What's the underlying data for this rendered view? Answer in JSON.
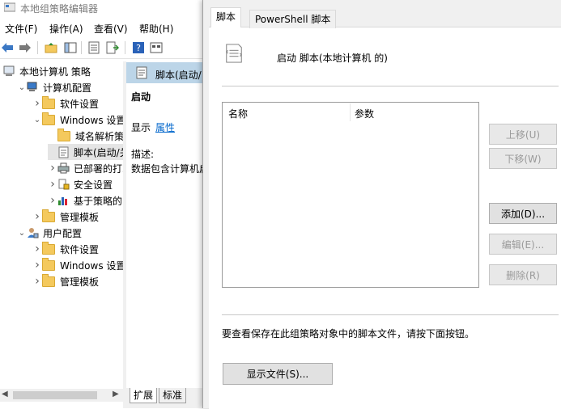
{
  "window": {
    "title": "本地组策略编辑器"
  },
  "menu": [
    "文件(F)",
    "操作(A)",
    "查看(V)",
    "帮助(H)"
  ],
  "tree": {
    "items": [
      {
        "label": "本地计算机 策略",
        "level": 0,
        "expander": "",
        "icon": "computer-policy-icon"
      },
      {
        "label": "计算机配置",
        "level": 1,
        "expander": "open",
        "icon": "computer-icon"
      },
      {
        "label": "软件设置",
        "level": 2,
        "expander": "closed",
        "icon": "folder-icon"
      },
      {
        "label": "Windows 设置",
        "level": 2,
        "expander": "open",
        "icon": "folder-icon"
      },
      {
        "label": "域名解析策略",
        "level": 3,
        "expander": "",
        "icon": "folder-icon"
      },
      {
        "label": "脚本(启动/关",
        "level": 3,
        "expander": "",
        "icon": "script-icon",
        "selected": true
      },
      {
        "label": "已部署的打印",
        "level": 3,
        "expander": "closed",
        "icon": "printer-icon"
      },
      {
        "label": "安全设置",
        "level": 3,
        "expander": "closed",
        "icon": "security-icon"
      },
      {
        "label": "基于策略的 C",
        "level": 3,
        "expander": "closed",
        "icon": "chart-icon"
      },
      {
        "label": "管理模板",
        "level": 2,
        "expander": "closed",
        "icon": "folder-icon"
      },
      {
        "label": "用户配置",
        "level": 1,
        "expander": "open",
        "icon": "user-icon"
      },
      {
        "label": "软件设置",
        "level": 2,
        "expander": "closed",
        "icon": "folder-icon"
      },
      {
        "label": "Windows 设置",
        "level": 2,
        "expander": "closed",
        "icon": "folder-icon"
      },
      {
        "label": "管理模板",
        "level": 2,
        "expander": "closed",
        "icon": "folder-icon"
      }
    ]
  },
  "detail": {
    "header": "脚本(启动/",
    "section": "启动",
    "show_label": "显示",
    "properties_link": "属性",
    "desc_label": "描述:",
    "desc_text": "数据包含计算机启"
  },
  "bottom_tabs": [
    "扩展",
    "标准"
  ],
  "dialog": {
    "tabs": [
      "脚本",
      "PowerShell 脚本"
    ],
    "title": "启动 脚本(本地计算机 的)",
    "columns": [
      "名称",
      "参数"
    ],
    "buttons": {
      "up": "上移(U)",
      "down": "下移(W)",
      "add": "添加(D)...",
      "edit": "编辑(E)...",
      "remove": "删除(R)"
    },
    "hint": "要查看保存在此组策略对象中的脚本文件，请按下面按钮。",
    "show_files": "显示文件(S)..."
  }
}
